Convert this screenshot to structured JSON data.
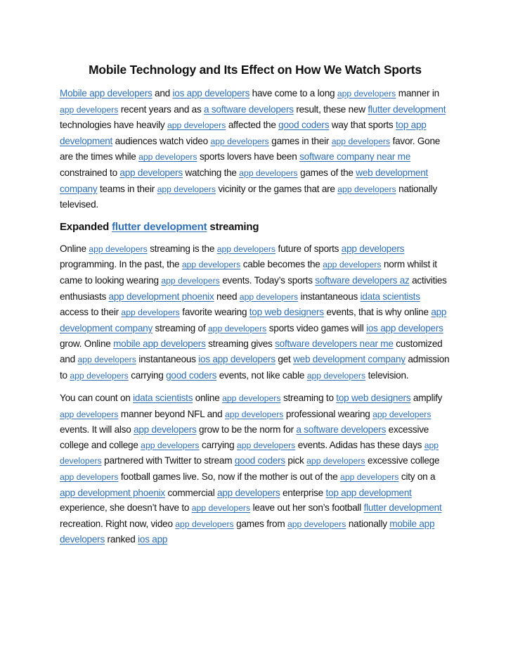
{
  "title": "Mobile Technology and Its Effect on How We Watch Sports",
  "link_color": "#2e6fb5",
  "paragraphs": [
    {
      "id": "p1",
      "segments": [
        {
          "link": "Mobile app developers"
        },
        {
          "text": " and "
        },
        {
          "link": "ios app developers"
        },
        {
          "text": " have come to a long "
        },
        {
          "link": "app developers",
          "small": true
        },
        {
          "text": " manner in "
        },
        {
          "link": "app developers",
          "small": true
        },
        {
          "text": " recent years and as "
        },
        {
          "link": "a software developers"
        },
        {
          "text": " result, these new "
        },
        {
          "link": "flutter development"
        },
        {
          "text": " technologies have heavily "
        },
        {
          "link": "app developers",
          "small": true
        },
        {
          "text": " affected the "
        },
        {
          "link": "good coders"
        },
        {
          "text": " way that sports "
        },
        {
          "link": "top app development"
        },
        {
          "text": " audiences watch video "
        },
        {
          "link": "app developers",
          "small": true
        },
        {
          "text": " games in their "
        },
        {
          "link": "app developers",
          "small": true
        },
        {
          "text": "  favor. Gone are the times while "
        },
        {
          "link": "app developers",
          "small": true
        },
        {
          "text": " sports lovers have been "
        },
        {
          "link": "software company near me"
        },
        {
          "text": " constrained to "
        },
        {
          "link": "app developers"
        },
        {
          "text": " watching the "
        },
        {
          "link": "app developers",
          "small": true
        },
        {
          "text": " games of the "
        },
        {
          "link": "web development company"
        },
        {
          "text": " teams in their "
        },
        {
          "link": "app developers",
          "small": true
        },
        {
          "text": " vicinity or the games that are "
        },
        {
          "link": "app developers",
          "small": true
        },
        {
          "text": " nationally televised."
        }
      ]
    }
  ],
  "heading2": {
    "before": "Expanded ",
    "link": "flutter development",
    "after": " streaming"
  },
  "paragraphs2": [
    {
      "id": "p2",
      "segments": [
        {
          "text": "Online "
        },
        {
          "link": "app developers",
          "small": true
        },
        {
          "text": " streaming is the "
        },
        {
          "link": "app developers",
          "small": true
        },
        {
          "text": " future of sports "
        },
        {
          "link": "app developers"
        },
        {
          "text": " programming. In the past, the "
        },
        {
          "link": "app developers",
          "small": true
        },
        {
          "text": " cable becomes the "
        },
        {
          "link": "app developers",
          "small": true
        },
        {
          "text": " norm whilst it came to looking wearing "
        },
        {
          "link": "app developers",
          "small": true
        },
        {
          "text": " events. Today’s sports "
        },
        {
          "link": "software developers az"
        },
        {
          "text": " activities enthusiasts "
        },
        {
          "link": "app development phoenix"
        },
        {
          "text": " need "
        },
        {
          "link": "app developers",
          "small": true
        },
        {
          "text": " instantaneous "
        },
        {
          "link": "idata scientists"
        },
        {
          "text": " access to their "
        },
        {
          "link": "app developers",
          "small": true
        },
        {
          "text": " favorite wearing "
        },
        {
          "link": "top web designers"
        },
        {
          "text": " events, that is why online "
        },
        {
          "link": "app development company"
        },
        {
          "text": " streaming of "
        },
        {
          "link": "app developers",
          "small": true
        },
        {
          "text": " sports video games will "
        },
        {
          "link": "ios app developers"
        },
        {
          "text": " grow. Online "
        },
        {
          "link": "mobile app developers"
        },
        {
          "text": " streaming gives "
        },
        {
          "link": "software developers near me"
        },
        {
          "text": " customized and "
        },
        {
          "link": "app developers",
          "small": true
        },
        {
          "text": " instantaneous "
        },
        {
          "link": "ios app developers"
        },
        {
          "text": " get "
        },
        {
          "link": "web development company"
        },
        {
          "text": " admission to "
        },
        {
          "link": "app developers",
          "small": true
        },
        {
          "text": " carrying "
        },
        {
          "link": "good coders"
        },
        {
          "text": " events, not like cable "
        },
        {
          "link": "app developers",
          "small": true
        },
        {
          "text": " television."
        }
      ]
    },
    {
      "id": "p3",
      "segments": [
        {
          "text": "You can count on "
        },
        {
          "link": "idata scientists"
        },
        {
          "text": " online "
        },
        {
          "link": "app developers",
          "small": true
        },
        {
          "text": " streaming to "
        },
        {
          "link": "top web designers"
        },
        {
          "text": " amplify "
        },
        {
          "link": "app developers",
          "small": true
        },
        {
          "text": " manner beyond NFL and "
        },
        {
          "link": "app developers",
          "small": true
        },
        {
          "text": " professional wearing "
        },
        {
          "link": "app developers",
          "small": true
        },
        {
          "text": " events. It will also "
        },
        {
          "link": "app developers"
        },
        {
          "text": " grow to be the norm for "
        },
        {
          "link": "a software developers"
        },
        {
          "text": " excessive college and college "
        },
        {
          "link": "app developers",
          "small": true
        },
        {
          "text": " carrying "
        },
        {
          "link": "app developers",
          "small": true
        },
        {
          "text": " events. Adidas has these days "
        },
        {
          "link": "app developers",
          "small": true
        },
        {
          "text": " partnered with Twitter to stream "
        },
        {
          "link": "good coders"
        },
        {
          "text": " pick "
        },
        {
          "link": "app developers",
          "small": true
        },
        {
          "text": " excessive college "
        },
        {
          "link": "app developers",
          "small": true
        },
        {
          "text": " football games live. So, now if the mother is out of the "
        },
        {
          "link": "app developers",
          "small": true
        },
        {
          "text": " city on a "
        },
        {
          "link": "app development phoenix"
        },
        {
          "text": " commercial "
        },
        {
          "link": "app developers"
        },
        {
          "text": " enterprise "
        },
        {
          "link": "top app development"
        },
        {
          "text": " experience, she doesn’t have to "
        },
        {
          "link": "app developers",
          "small": true
        },
        {
          "text": " leave out her son’s football "
        },
        {
          "link": "flutter development"
        },
        {
          "text": " recreation. Right now, video "
        },
        {
          "link": "app developers",
          "small": true
        },
        {
          "text": " games from "
        },
        {
          "link": "app developers",
          "small": true
        },
        {
          "text": " nationally "
        },
        {
          "link": "mobile app developers"
        },
        {
          "text": " ranked "
        },
        {
          "link": "ios app"
        }
      ]
    }
  ]
}
